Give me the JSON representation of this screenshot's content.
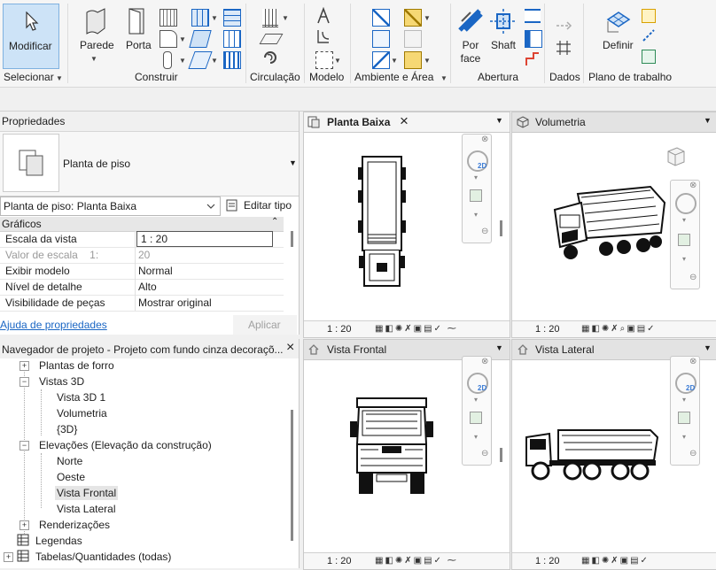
{
  "ribbon": {
    "modify": "Modificar",
    "select": "Selecionar",
    "wall": "Parede",
    "door": "Porta",
    "build": "Construir",
    "circulation": "Circulação",
    "model": "Modelo",
    "room_area": "Ambiente e Área",
    "by_face": "Por face",
    "shaft": "Shaft",
    "opening": "Abertura",
    "datum": "Dados",
    "set": "Definir",
    "work_plane": "Plano de trabalho"
  },
  "properties": {
    "title": "Propriedades",
    "type_name": "Planta de piso",
    "instance": "Planta de piso: Planta Baixa",
    "edit_type": "Editar tipo",
    "group": "Gráficos",
    "rows": [
      {
        "key": "Escala da vista",
        "value": "1 : 20"
      },
      {
        "key": "Valor de escala    1:",
        "value": "20"
      },
      {
        "key": "Exibir modelo",
        "value": "Normal"
      },
      {
        "key": "Nível de detalhe",
        "value": "Alto"
      },
      {
        "key": "Visibilidade de peças",
        "value": "Mostrar original"
      }
    ],
    "help": "Ajuda de propriedades",
    "apply": "Aplicar"
  },
  "browser": {
    "title": "Navegador de projeto - Projeto com fundo cinza decoraçõ...",
    "items": [
      "Plantas de forro",
      "Vistas 3D",
      "Vista 3D 1",
      "Volumetria",
      "{3D}",
      "Elevações (Elevação da construção)",
      "Norte",
      "Oeste",
      "Vista Frontal",
      "Vista Lateral",
      "Renderizações",
      "Legendas",
      "Tabelas/Quantidades (todas)"
    ]
  },
  "views": [
    {
      "title": "Planta Baixa",
      "scale": "1 : 20"
    },
    {
      "title": "Volumetria",
      "scale": "1 : 20"
    },
    {
      "title": "Vista Frontal",
      "scale": "1 : 20"
    },
    {
      "title": "Vista Lateral",
      "scale": "1 : 20"
    }
  ],
  "icons": {
    "close": "×",
    "dropdown": "▾",
    "nav_2d": "2D"
  },
  "colors": {
    "accent": "#1a66c4",
    "selected_bg": "#cde3f7",
    "link": "#1a66c4"
  }
}
